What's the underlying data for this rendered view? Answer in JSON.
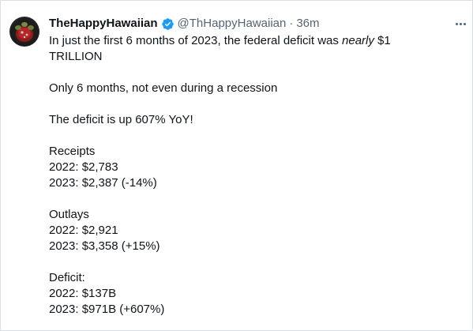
{
  "tweet": {
    "display_name": "TheHappyHawaiian",
    "verified_icon": "verified-badge-icon",
    "handle": "@ThHappyHawaiian",
    "separator": "·",
    "time": "36m",
    "more_icon": "more-options-icon",
    "intro_before": "In just the first 6 months of 2023, the federal deficit was ",
    "intro_emph": "nearly",
    "intro_after": " $1",
    "intro_line2": "TRILLION",
    "line_recession": "Only 6 months, not even during a recession",
    "line_up": "The deficit is up 607% YoY!",
    "receipts": {
      "heading": "Receipts",
      "y2022": "2022: $2,783",
      "y2023": "2023: $2,387 (-14%)"
    },
    "outlays": {
      "heading": "Outlays",
      "y2022": "2022: $2,921",
      "y2023": "2023: $3,358 (+15%)"
    },
    "deficit": {
      "heading": "Deficit:",
      "y2022": "2022: $137B",
      "y2023": "2023: $971B (+607%)"
    }
  },
  "colors": {
    "text": "#0f1419",
    "secondary": "#536471",
    "verified_blue": "#1d9bf0",
    "border": "#d9dfe3"
  }
}
